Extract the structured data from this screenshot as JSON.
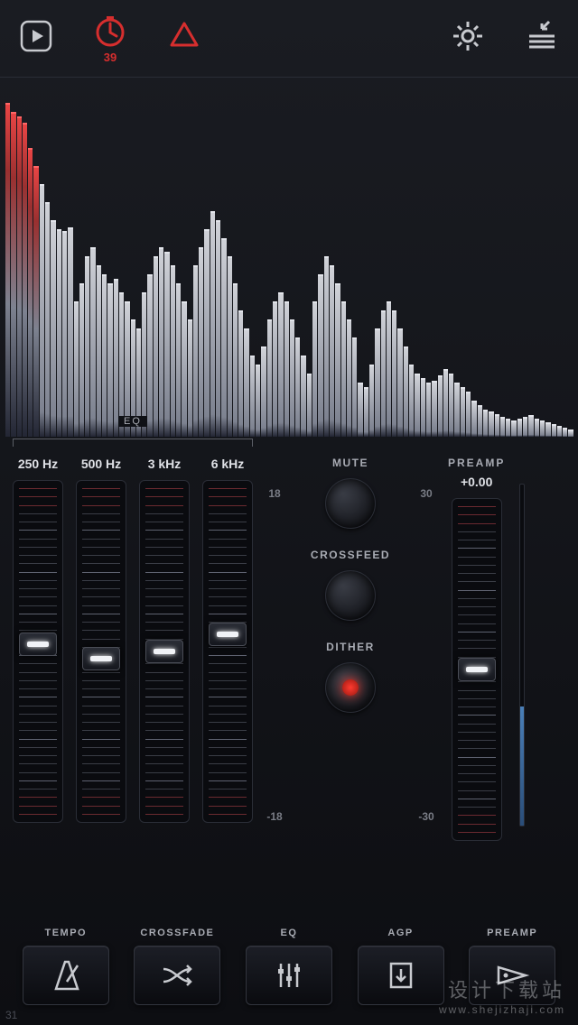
{
  "toolbar": {
    "timer_count": "39"
  },
  "spectrum": {
    "bars": [
      370,
      360,
      355,
      348,
      320,
      300,
      280,
      260,
      240,
      230,
      228,
      232,
      150,
      170,
      200,
      210,
      190,
      180,
      170,
      175,
      160,
      150,
      130,
      120,
      160,
      180,
      200,
      210,
      205,
      190,
      170,
      150,
      130,
      190,
      210,
      230,
      250,
      240,
      220,
      200,
      170,
      140,
      120,
      90,
      80,
      100,
      130,
      150,
      160,
      150,
      130,
      110,
      90,
      70,
      150,
      180,
      200,
      190,
      170,
      150,
      130,
      110,
      60,
      55,
      80,
      120,
      140,
      150,
      140,
      120,
      100,
      80,
      70,
      65,
      60,
      62,
      68,
      75,
      70,
      60,
      55,
      50,
      40,
      35,
      30,
      28,
      25,
      22,
      20,
      18,
      20,
      22,
      24,
      20,
      18,
      16,
      14,
      12,
      10,
      8
    ],
    "peak_count": 6
  },
  "eq": {
    "group_label": "EQ",
    "bands": [
      {
        "freq": "250 Hz",
        "pos": 48
      },
      {
        "freq": "500 Hz",
        "pos": 52
      },
      {
        "freq": "3 kHz",
        "pos": 50
      },
      {
        "freq": "6 kHz",
        "pos": 45
      }
    ],
    "scale_top": "18",
    "scale_bot": "-18"
  },
  "knobs": {
    "mute": "MUTE",
    "crossfeed": "CROSSFEED",
    "dither": "DITHER"
  },
  "preamp": {
    "title": "PREAMP",
    "value": "+0.00",
    "scale_top": "30",
    "scale_bot": "-30",
    "pos": 50
  },
  "buttons": {
    "tempo": "TEMPO",
    "crossfade": "CROSSFADE",
    "eq": "EQ",
    "agp": "AGP",
    "preamp": "PREAMP"
  },
  "watermark": {
    "line1": "设计下载站",
    "line2": "www.shejizhaji.com"
  },
  "corner": "31"
}
